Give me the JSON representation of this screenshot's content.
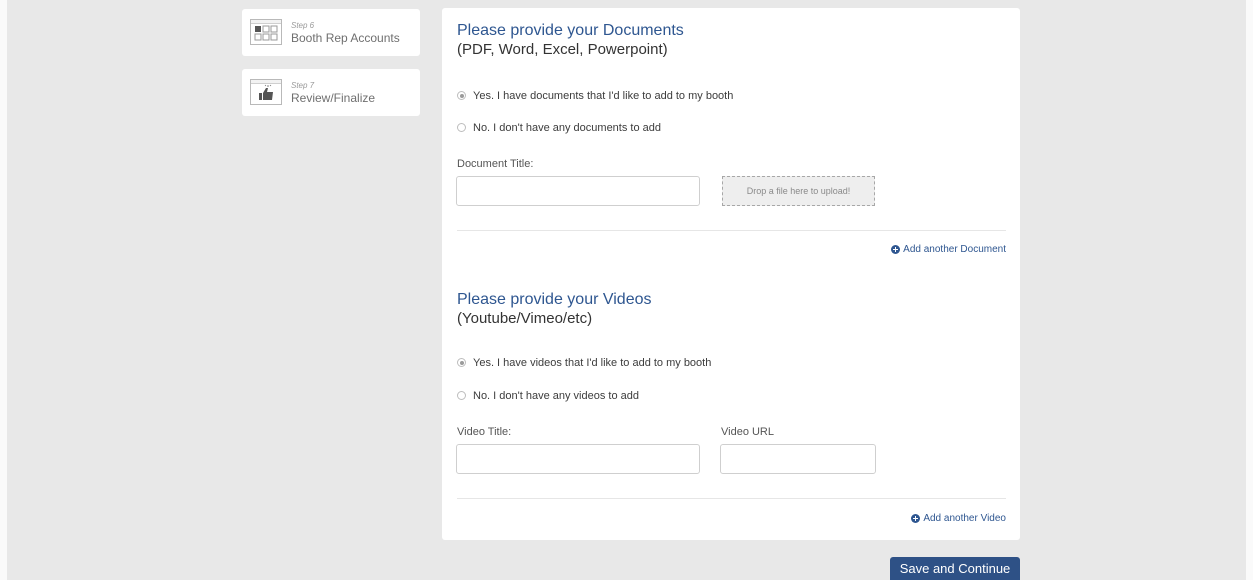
{
  "steps": [
    {
      "number": "Step 6",
      "name": "Booth Rep Accounts",
      "icon": "grid-icon"
    },
    {
      "number": "Step 7",
      "name": "Review/Finalize",
      "icon": "thumbs-up-icon"
    }
  ],
  "documents": {
    "title": "Please provide your Documents",
    "subtitle": "(PDF, Word, Excel, Powerpoint)",
    "options": [
      {
        "label": "Yes. I have documents that I'd like to add to my booth",
        "checked": true
      },
      {
        "label": "No. I don't have any documents to add",
        "checked": false
      }
    ],
    "field_label": "Document Title:",
    "field_value": "",
    "drop_text": "Drop a file here to upload!",
    "add_link": "Add another Document"
  },
  "videos": {
    "title": "Please provide your Videos",
    "subtitle": "(Youtube/Vimeo/etc)",
    "options": [
      {
        "label": "Yes. I have videos that I'd like to add to my booth",
        "checked": true
      },
      {
        "label": "No. I don't have any videos to add",
        "checked": false
      }
    ],
    "title_label": "Video Title:",
    "title_value": "",
    "url_label": "Video URL",
    "url_value": "",
    "add_link": "Add another Video"
  },
  "save_button": "Save and Continue",
  "colors": {
    "accent": "#2e5690",
    "button": "#2e5186",
    "background": "#e8e8e8"
  }
}
